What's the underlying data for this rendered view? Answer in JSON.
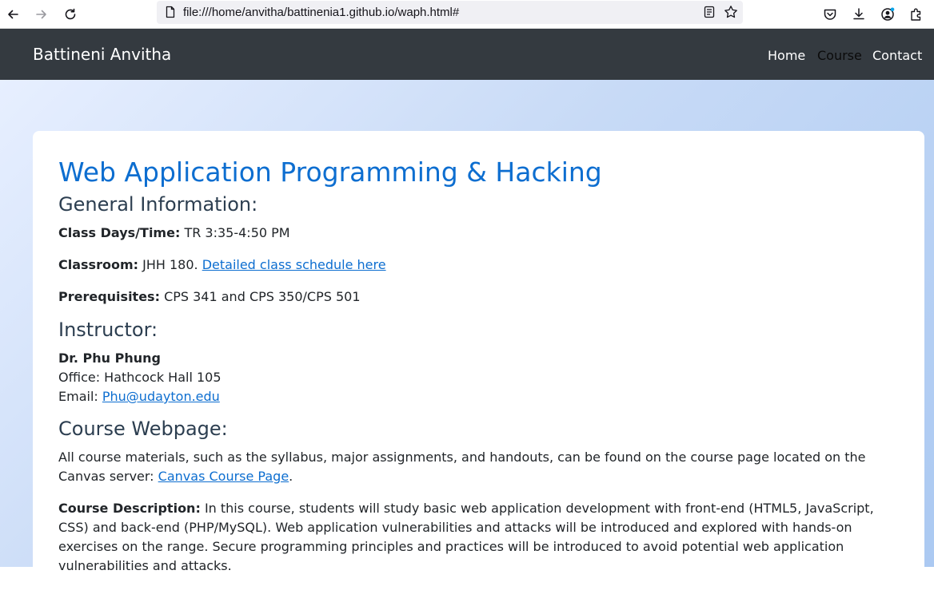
{
  "browser": {
    "url": "file:///home/anvitha/battinenia1.github.io/waph.html#"
  },
  "navbar": {
    "brand": "Battineni Anvitha",
    "links": [
      {
        "label": "Home",
        "active": false
      },
      {
        "label": "Course",
        "active": true
      },
      {
        "label": "Contact",
        "active": false
      }
    ]
  },
  "content": {
    "title": "Web Application Programming & Hacking",
    "general": {
      "heading": "General Information:",
      "class_days_label": "Class Days/Time:",
      "class_days_value": "TR 3:35-4:50 PM",
      "classroom_label": "Classroom:",
      "classroom_value": "JHH 180.",
      "schedule_link": "Detailed class schedule here",
      "prereq_label": "Prerequisites:",
      "prereq_value": "CPS 341 and CPS 350/CPS 501"
    },
    "instructor": {
      "heading": "Instructor:",
      "name": "Dr. Phu Phung",
      "office": "Office: Hathcock Hall 105",
      "email_label": "Email:",
      "email_link": "Phu@udayton.edu"
    },
    "webpage": {
      "heading": "Course Webpage:",
      "text": "All course materials, such as the syllabus, major assignments, and handouts, can be found on the course page located on the Canvas server:",
      "canvas_link": "Canvas Course Page",
      "period": ".",
      "desc_label": "Course Description:",
      "desc_text": "In this course, students will study basic web application development with front-end (HTML5, JavaScript, CSS) and back-end (PHP/MySQL). Web application vulnerabilities and attacks will be introduced and explored with hands-on exercises on the range. Secure programming principles and practices will be introduced to avoid potential web application vulnerabilities and attacks."
    }
  },
  "icons": {
    "back": "back-arrow-icon",
    "forward": "forward-arrow-icon",
    "reload": "reload-icon",
    "page": "page-icon",
    "reader": "reader-view-icon",
    "bookmark": "star-icon",
    "pocket": "pocket-icon",
    "downloads": "download-icon",
    "account": "account-icon",
    "extensions": "extensions-icon"
  },
  "colors": {
    "navbar_bg": "#343a40",
    "title": "#0d6ed0",
    "link": "#0d6ed0"
  }
}
